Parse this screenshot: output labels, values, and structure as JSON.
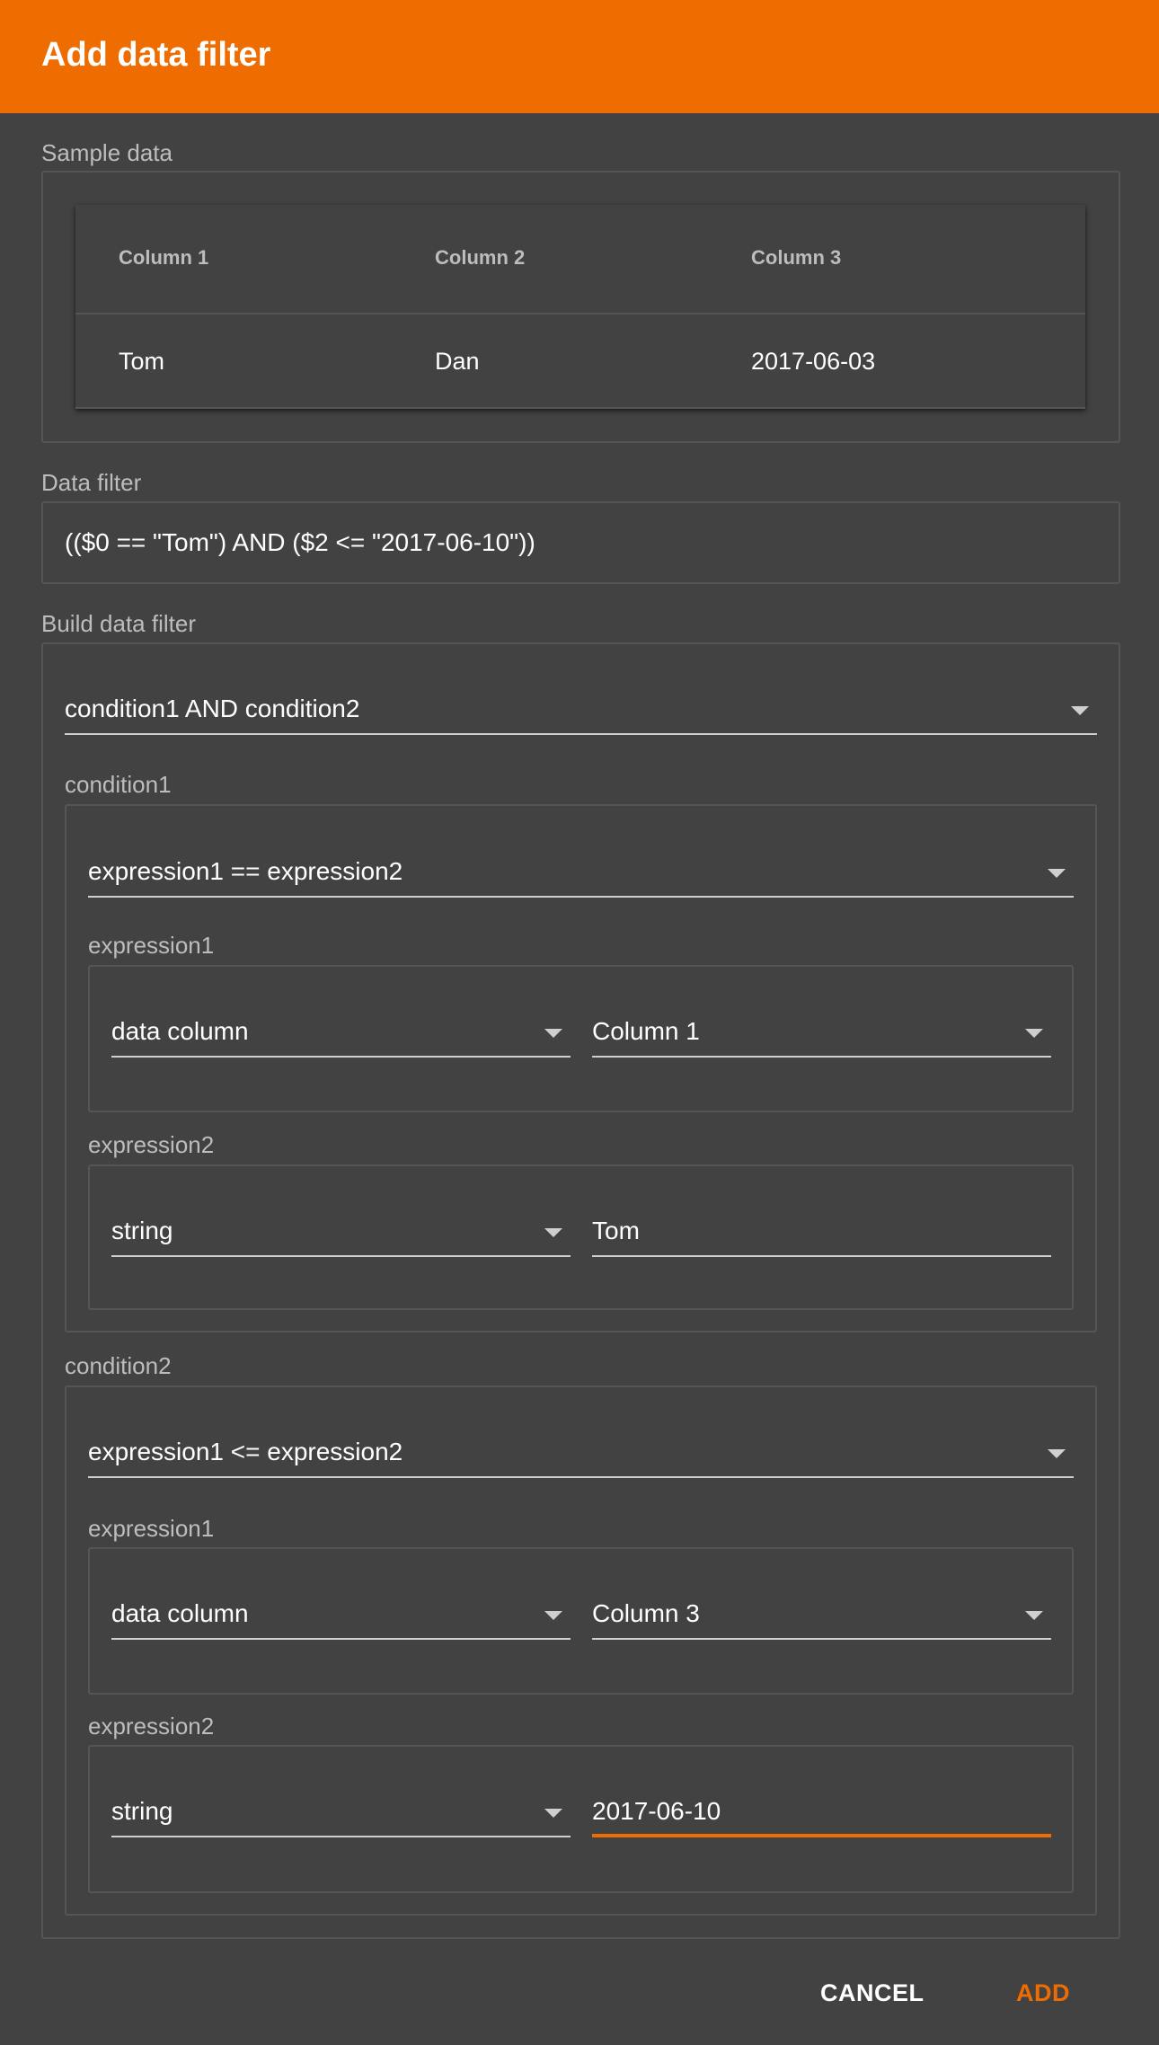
{
  "dialog": {
    "title": "Add data filter",
    "accent_color": "#EF6C00"
  },
  "sample_data": {
    "label": "Sample data",
    "columns": [
      "Column 1",
      "Column 2",
      "Column 3"
    ],
    "rows": [
      [
        "Tom",
        "Dan",
        "2017-06-03"
      ]
    ]
  },
  "data_filter": {
    "label": "Data filter",
    "value": "(($0 == \"Tom\") AND ($2 <= \"2017-06-10\"))"
  },
  "build_filter": {
    "label": "Build data filter",
    "operator_select": "condition1 AND condition2",
    "conditions": [
      {
        "label": "condition1",
        "comparison_select": "expression1 == expression2",
        "expression1": {
          "label": "expression1",
          "type_select": "data column",
          "value_select": "Column 1"
        },
        "expression2": {
          "label": "expression2",
          "type_select": "string",
          "value_input": "Tom"
        }
      },
      {
        "label": "condition2",
        "comparison_select": "expression1 <= expression2",
        "expression1": {
          "label": "expression1",
          "type_select": "data column",
          "value_select": "Column 3"
        },
        "expression2": {
          "label": "expression2",
          "type_select": "string",
          "value_input": "2017-06-10"
        }
      }
    ]
  },
  "actions": {
    "cancel_label": "CANCEL",
    "add_label": "ADD"
  },
  "icons": {
    "dropdown": "triangle-down"
  }
}
